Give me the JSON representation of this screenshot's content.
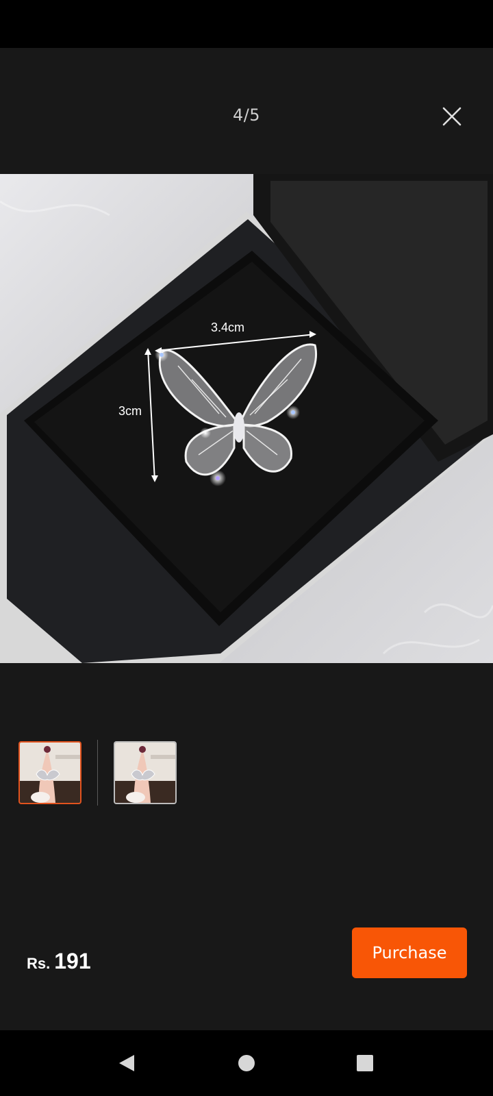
{
  "viewer": {
    "counter": "4/5",
    "close_icon": "close-icon"
  },
  "photo": {
    "width_label": "3.4cm",
    "height_label": "3cm"
  },
  "thumbnails": [
    {
      "name": "thumbnail-1",
      "selected": true
    },
    {
      "name": "thumbnail-2",
      "selected": false
    }
  ],
  "footer": {
    "currency": "Rs.",
    "amount": "191",
    "purchase_label": "Purchase"
  },
  "colors": {
    "accent": "#f85606",
    "selected_border": "#e2531e",
    "background": "#181818"
  },
  "nav": {
    "back_icon": "back-triangle-icon",
    "home_icon": "home-circle-icon",
    "recents_icon": "recents-square-icon"
  }
}
